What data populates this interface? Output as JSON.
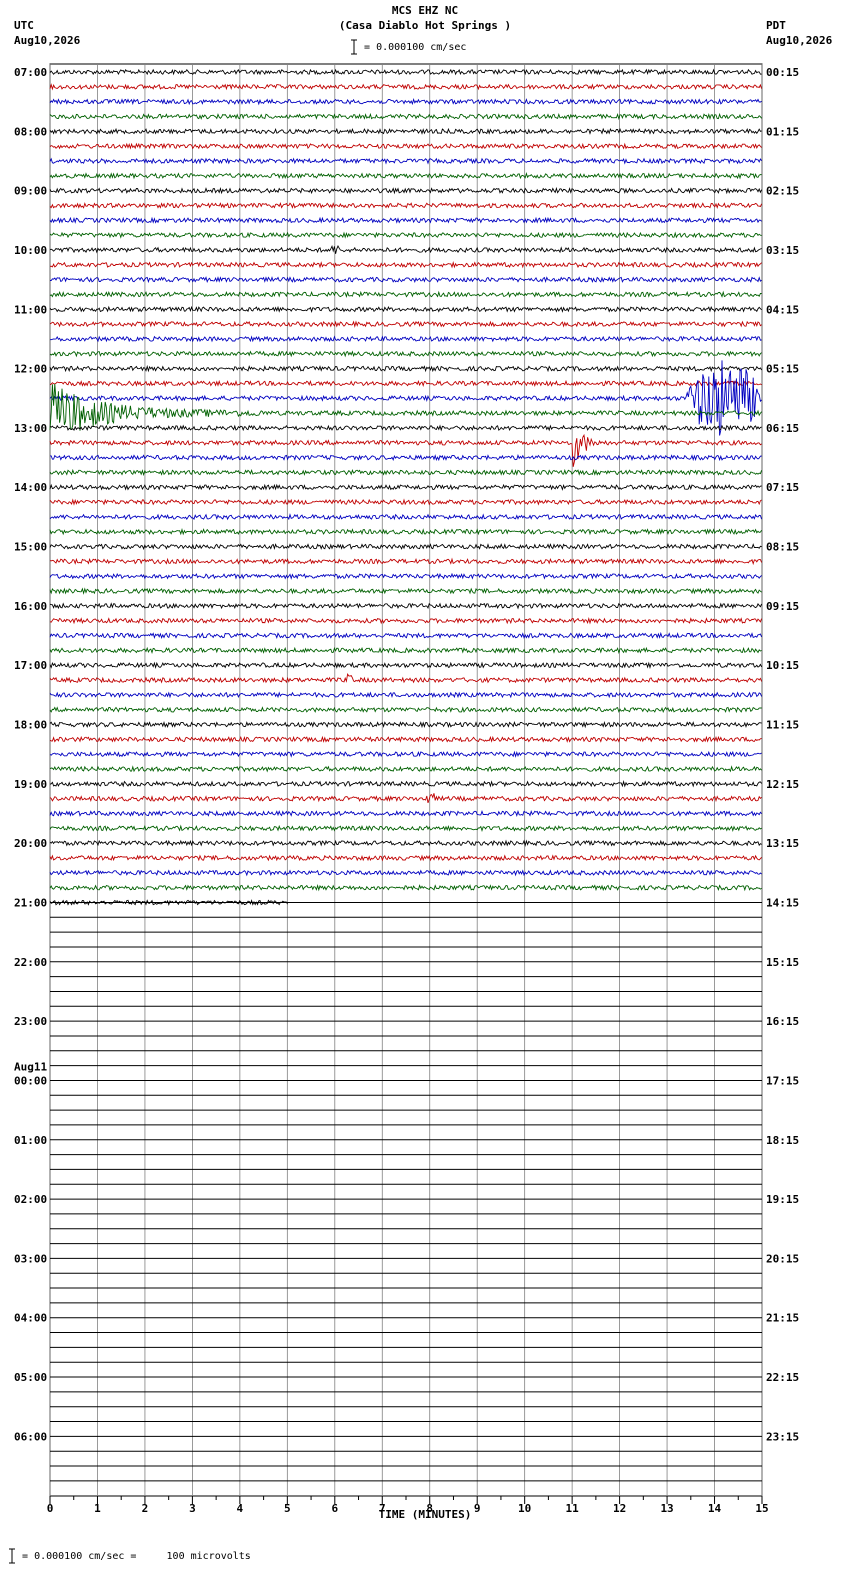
{
  "header": {
    "title_line1": "MCS EHZ NC",
    "title_line2": "(Casa Diablo Hot Springs )",
    "scale_note": "= 0.000100 cm/sec",
    "left_timezone": "UTC",
    "left_date": "Aug10,2026",
    "right_timezone": "PDT",
    "right_date": "Aug10,2026"
  },
  "footer": {
    "text": "= 0.000100 cm/sec =     100 microvolts"
  },
  "chart_data": {
    "type": "line",
    "title": "MCS EHZ NC (Casa Diablo Hot Springs )",
    "xlabel": "TIME (MINUTES)",
    "x_ticks": [
      "0",
      "1",
      "2",
      "3",
      "4",
      "5",
      "6",
      "7",
      "8",
      "9",
      "10",
      "11",
      "12",
      "13",
      "14",
      "15"
    ],
    "xlim": [
      0,
      15
    ],
    "grid": true,
    "trace_colors": [
      "#000000",
      "#c00000",
      "#0000c0",
      "#006000"
    ],
    "traces_per_hour": 4,
    "filled_traces": 56,
    "last_trace_end_minute": 5,
    "left_hour_labels": [
      {
        "row": 0,
        "label": "07:00"
      },
      {
        "row": 4,
        "label": "08:00"
      },
      {
        "row": 8,
        "label": "09:00"
      },
      {
        "row": 12,
        "label": "10:00"
      },
      {
        "row": 16,
        "label": "11:00"
      },
      {
        "row": 20,
        "label": "12:00"
      },
      {
        "row": 24,
        "label": "13:00"
      },
      {
        "row": 28,
        "label": "14:00"
      },
      {
        "row": 32,
        "label": "15:00"
      },
      {
        "row": 36,
        "label": "16:00"
      },
      {
        "row": 40,
        "label": "17:00"
      },
      {
        "row": 44,
        "label": "18:00"
      },
      {
        "row": 48,
        "label": "19:00"
      },
      {
        "row": 52,
        "label": "20:00"
      },
      {
        "row": 56,
        "label": "21:00"
      },
      {
        "row": 60,
        "label": "22:00"
      },
      {
        "row": 64,
        "label": "23:00"
      },
      {
        "row": 68,
        "label": "00:00",
        "date": "Aug11"
      },
      {
        "row": 72,
        "label": "01:00"
      },
      {
        "row": 76,
        "label": "02:00"
      },
      {
        "row": 80,
        "label": "03:00"
      },
      {
        "row": 84,
        "label": "04:00"
      },
      {
        "row": 88,
        "label": "05:00"
      },
      {
        "row": 92,
        "label": "06:00"
      }
    ],
    "right_hour_labels": [
      "00:15",
      "01:15",
      "02:15",
      "03:15",
      "04:15",
      "05:15",
      "06:15",
      "07:15",
      "08:15",
      "09:15",
      "10:15",
      "11:15",
      "12:15",
      "13:15",
      "14:15",
      "15:15",
      "16:15",
      "17:15",
      "18:15",
      "19:15",
      "20:15",
      "21:15",
      "22:15",
      "23:15"
    ],
    "events": [
      {
        "trace": 12,
        "minute": 5.9,
        "amplitude": 5,
        "duration": 0.2
      },
      {
        "trace": 22,
        "minute": 13.4,
        "amplitude": 40,
        "duration": 1.6,
        "spindle": true
      },
      {
        "trace": 23,
        "minute": 0.0,
        "amplitude": 30,
        "duration": 4.5,
        "decay": true
      },
      {
        "trace": 25,
        "minute": 11.0,
        "amplitude": 28,
        "duration": 1.2,
        "pulse": true
      },
      {
        "trace": 41,
        "minute": 6.2,
        "amplitude": 6,
        "duration": 0.2
      },
      {
        "trace": 49,
        "minute": 7.9,
        "amplitude": 6,
        "duration": 0.2
      }
    ]
  }
}
